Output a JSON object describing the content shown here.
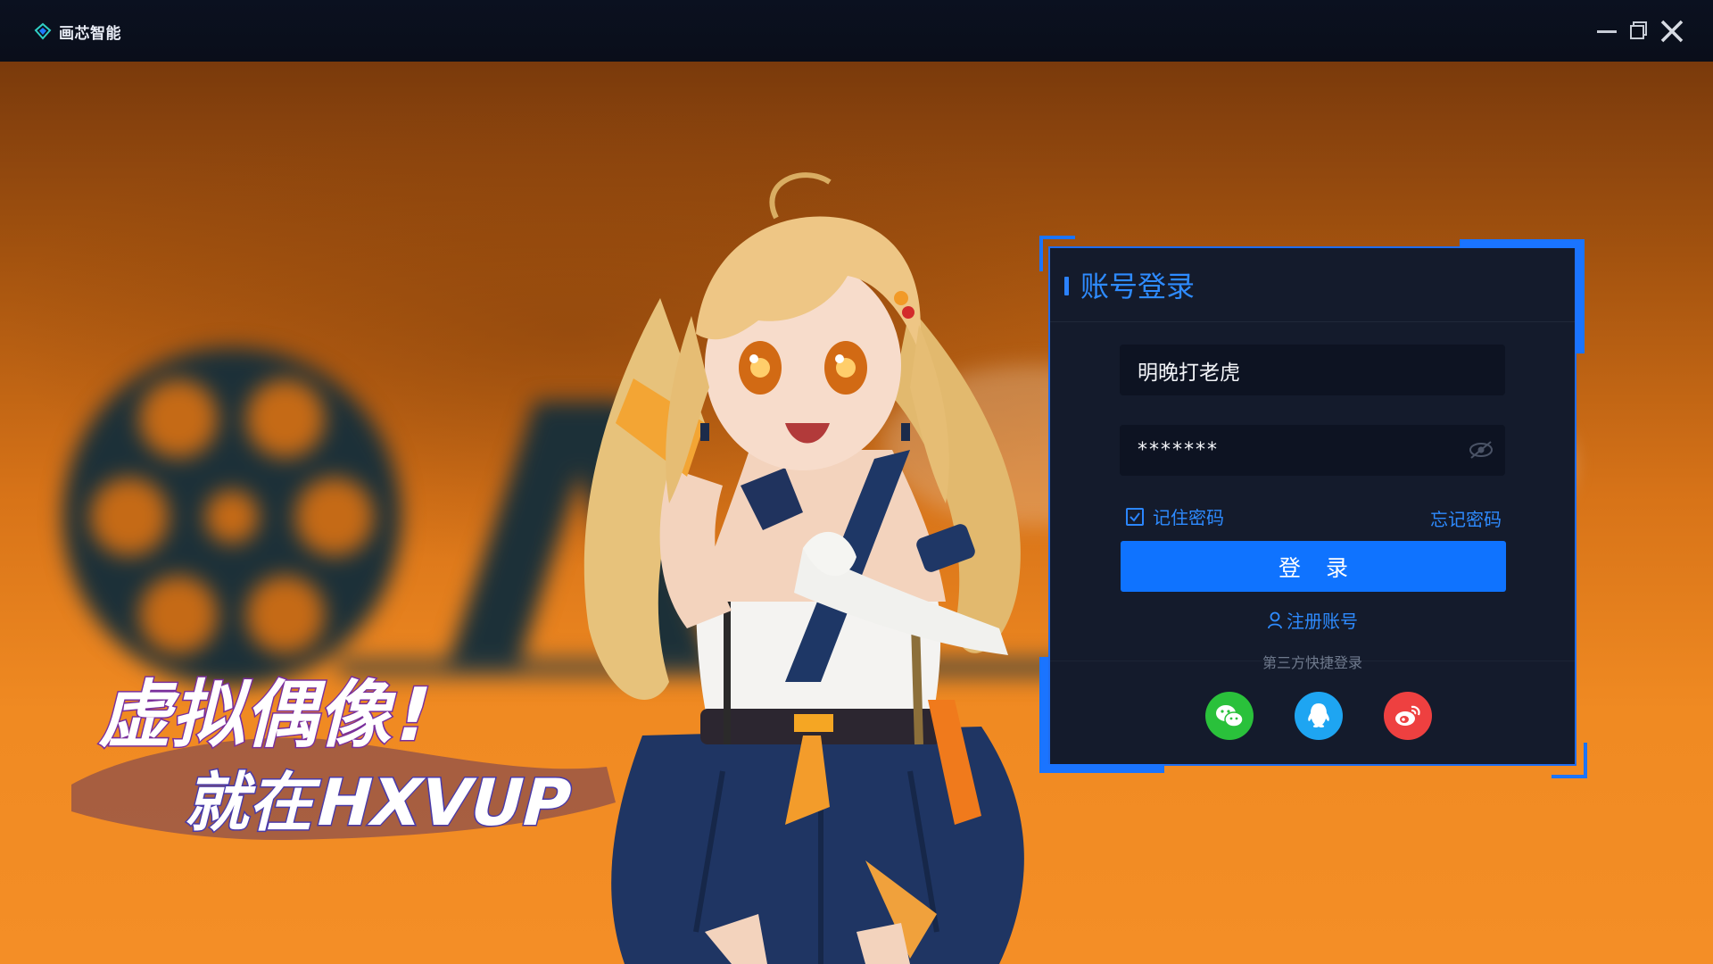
{
  "app": {
    "title": "画芯智能"
  },
  "window_controls": {
    "minimize": "minimize-icon",
    "restore": "restore-icon",
    "close": "close-icon"
  },
  "background": {
    "slogan_line1": "虚拟偶像!",
    "slogan_line2": "就在HXVUP"
  },
  "login": {
    "header": "账号登录",
    "username_value": "明晚打老虎",
    "password_value": "*******",
    "remember_label": "记住密码",
    "remember_checked": true,
    "forgot_label": "忘记密码",
    "login_button": "登 录",
    "register_label": "注册账号",
    "third_party_label": "第三方快捷登录",
    "third_party": [
      "wechat-icon",
      "qq-icon",
      "weibo-icon"
    ]
  },
  "colors": {
    "accent": "#2e8bff",
    "button": "#0f73ff",
    "panel": "#141b2c",
    "wechat": "#2ac13b",
    "qq": "#1ea5f2",
    "weibo": "#ee4040"
  }
}
